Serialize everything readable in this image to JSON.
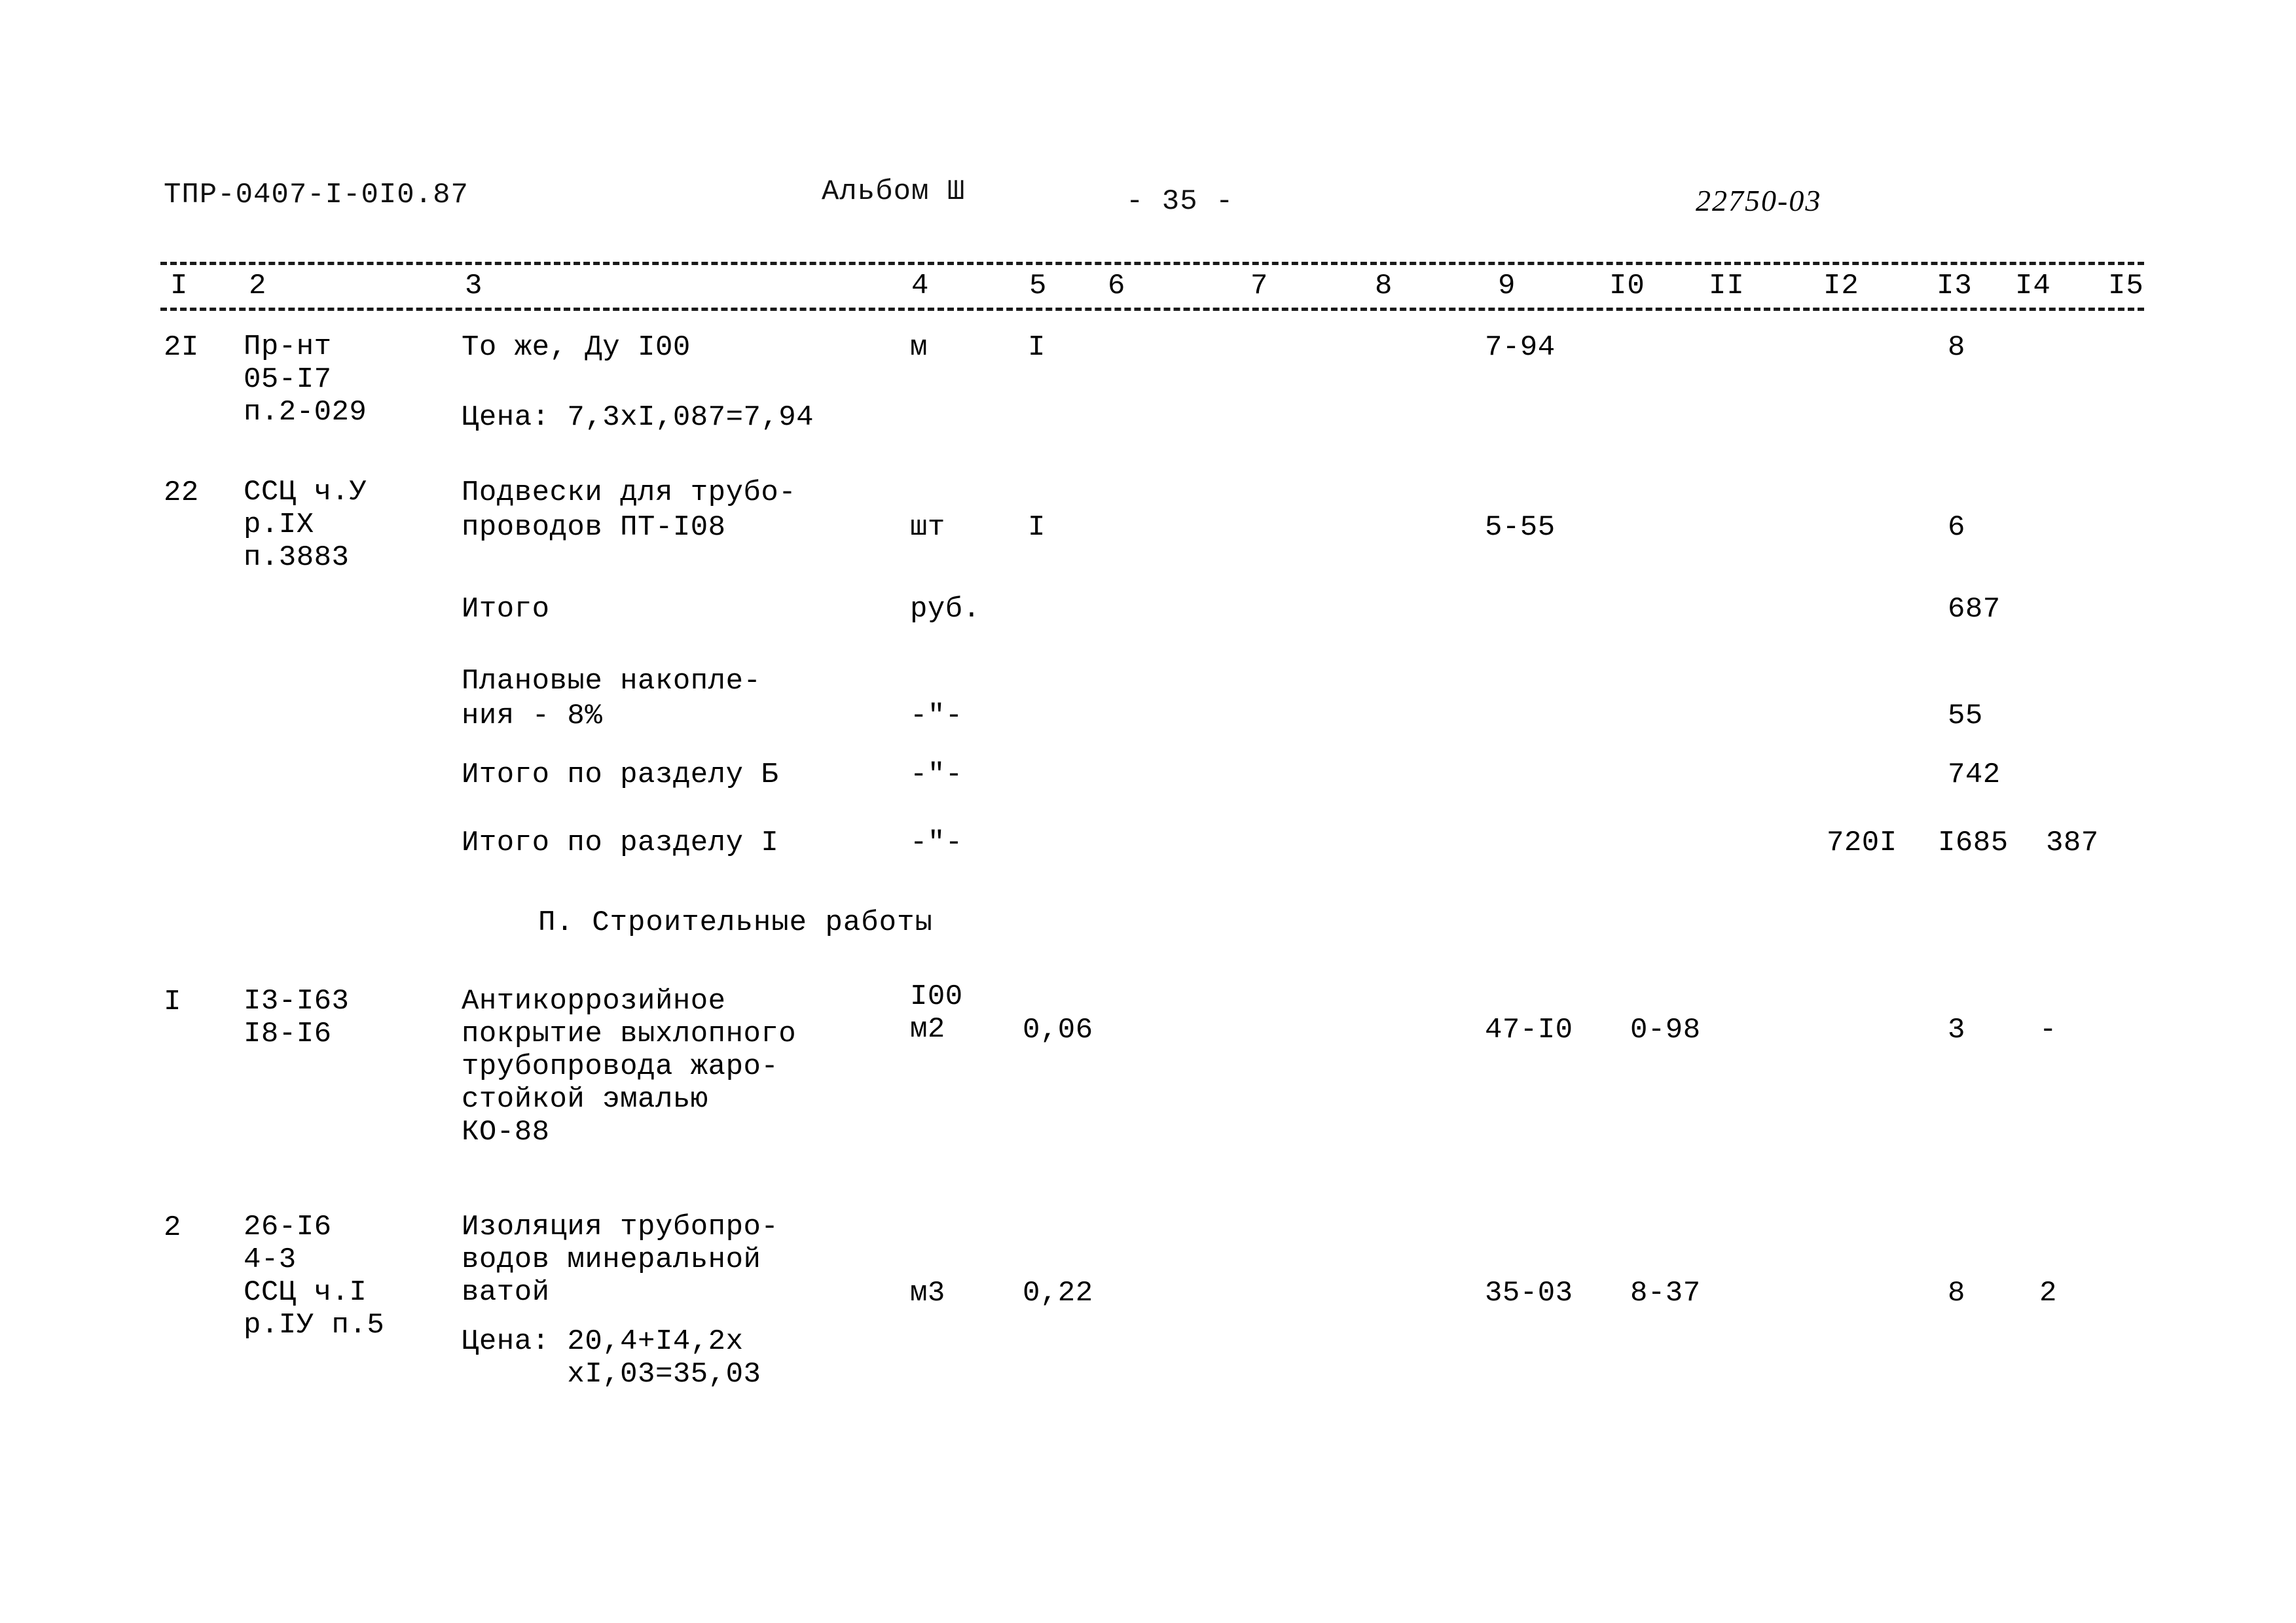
{
  "page": {
    "doc_code": "ТПР-0407-I-0I0.87",
    "album_label": "Альбом Ш",
    "page_number": "- 35 -",
    "sheet_number": "22750-03"
  },
  "table": {
    "column_numbers": [
      "I",
      "2",
      "3",
      "4",
      "5",
      "6",
      "7",
      "8",
      "9",
      "I0",
      "II",
      "I2",
      "I3",
      "I4",
      "I5"
    ],
    "rows": [
      {
        "no": "2I",
        "code": "Пр-нт\n05-I7\nп.2-029",
        "description": "То же, Ду I00",
        "description_note": "Цена: 7,3хI,087=7,94",
        "unit": "м",
        "qty": "I",
        "col9": "7-94",
        "col13": "8"
      },
      {
        "no": "22",
        "code": "ССЦ ч.У\nр.IX\nп.3883",
        "description": "Подвески для трубо-\nпроводов ПТ-I08",
        "unit": "шт",
        "qty": "I",
        "col9": "5-55",
        "col13": "6"
      }
    ],
    "summary_rows": [
      {
        "label": "Итого",
        "unit": "руб.",
        "col13": "687"
      },
      {
        "label": "Плановые накопле-\nния - 8%",
        "unit": "-\"-",
        "col13": "55"
      },
      {
        "label": "Итого по разделу Б",
        "unit": "-\"-",
        "col13": "742"
      },
      {
        "label": "Итого по разделу I",
        "unit": "-\"-",
        "col12": "720I",
        "col13": "I685",
        "col14": "387"
      }
    ],
    "section_heading": "П. Строительные работы",
    "section2_rows": [
      {
        "no": "I",
        "code": "I3-I63\nI8-I6",
        "description": "Антикоррозийное\nпокрытие выхлопного\nтрубопровода жаро-\nстойкой эмалью\nКО-88",
        "unit": "I00\nм2",
        "qty": "0,06",
        "col9": "47-I0",
        "col10": "0-98",
        "col13": "3",
        "col14": "-"
      },
      {
        "no": "2",
        "code": "26-I6\n4-3\nССЦ ч.I\nр.IУ п.5",
        "description": "Изоляция трубопро-\nводов минеральной\nватой",
        "description_note": "Цена: 20,4+I4,2х\n      хI,03=35,03",
        "unit": "м3",
        "qty": "0,22",
        "col9": "35-03",
        "col10": "8-37",
        "col13": "8",
        "col14": "2"
      }
    ]
  }
}
